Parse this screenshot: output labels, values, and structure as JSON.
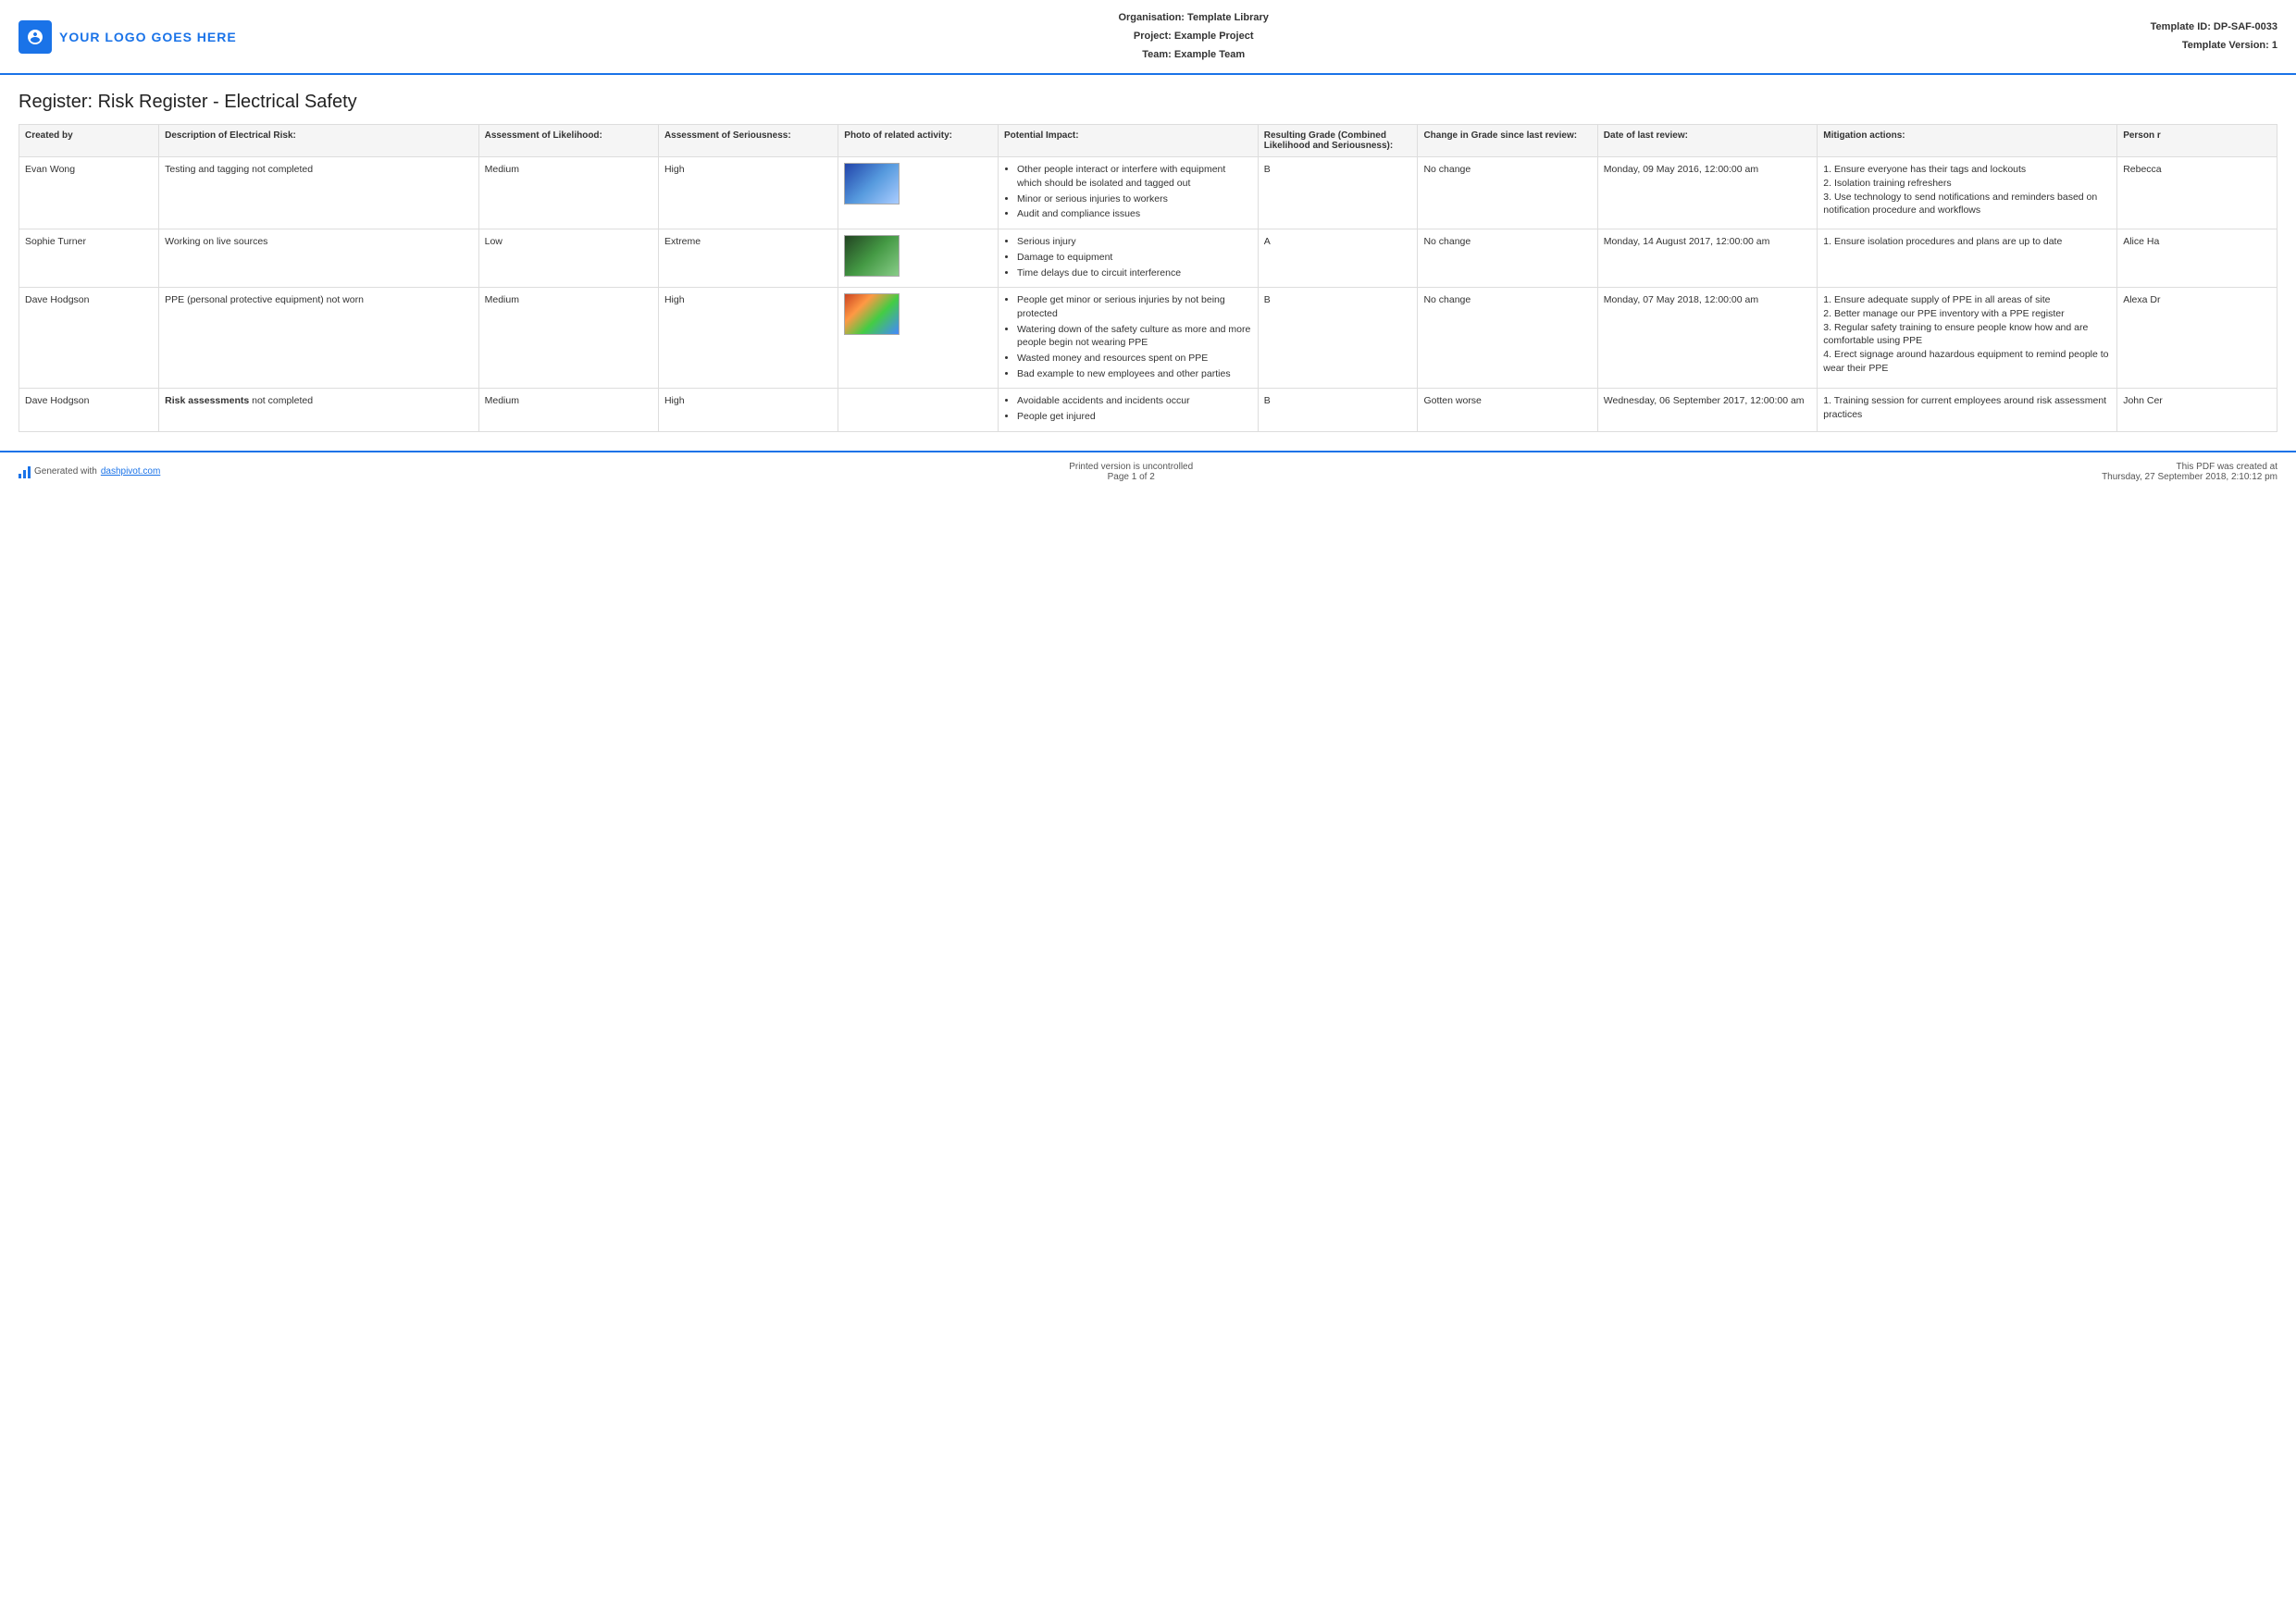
{
  "header": {
    "logo_text": "YOUR LOGO GOES HERE",
    "org_label": "Organisation:",
    "org_value": "Template Library",
    "project_label": "Project:",
    "project_value": "Example Project",
    "team_label": "Team:",
    "team_value": "Example Team",
    "template_id_label": "Template ID:",
    "template_id_value": "DP-SAF-0033",
    "template_version_label": "Template Version:",
    "template_version_value": "1"
  },
  "page_title": "Register: Risk Register - Electrical Safety",
  "table": {
    "columns": [
      "Created by",
      "Description of Electrical Risk:",
      "Assessment of Likelihood:",
      "Assessment of Seriousness:",
      "Photo of related activity:",
      "Potential Impact:",
      "Resulting Grade (Combined Likelihood and Seriousness):",
      "Change in Grade since last review:",
      "Date of last review:",
      "Mitigation actions:",
      "Person r"
    ],
    "rows": [
      {
        "created_by": "Evan Wong",
        "description": "Testing and tagging not completed",
        "likelihood": "Medium",
        "seriousness": "High",
        "has_photo": true,
        "photo_type": "blue",
        "impact": [
          "Other people interact or interfere with equipment which should be isolated and tagged out",
          "Minor or serious injuries to workers",
          "Audit and compliance issues"
        ],
        "grade": "B",
        "change": "No change",
        "date": "Monday, 09 May 2016, 12:00:00 am",
        "mitigation": "1. Ensure everyone has their tags and lockouts\n2. Isolation training refreshers\n3. Use technology to send notifications and reminders based on notification procedure and workflows",
        "person": "Rebecca"
      },
      {
        "created_by": "Sophie Turner",
        "description": "Working on live sources",
        "likelihood": "Low",
        "seriousness": "Extreme",
        "has_photo": true,
        "photo_type": "green",
        "impact": [
          "Serious injury",
          "Damage to equipment",
          "Time delays due to circuit interference"
        ],
        "grade": "A",
        "change": "No change",
        "date": "Monday, 14 August 2017, 12:00:00 am",
        "mitigation": "1. Ensure isolation procedures and plans are up to date",
        "person": "Alice Ha"
      },
      {
        "created_by": "Dave Hodgson",
        "description": "PPE (personal protective equipment) not worn",
        "likelihood": "Medium",
        "seriousness": "High",
        "has_photo": true,
        "photo_type": "multi",
        "impact": [
          "People get minor or serious injuries by not being protected",
          "Watering down of the safety culture as more and more people begin not wearing PPE",
          "Wasted money and resources spent on PPE",
          "Bad example to new employees and other parties"
        ],
        "grade": "B",
        "change": "No change",
        "date": "Monday, 07 May 2018, 12:00:00 am",
        "mitigation": "1. Ensure adequate supply of PPE in all areas of site\n2. Better manage our PPE inventory with a PPE register\n3. Regular safety training to ensure people know how and are comfortable using PPE\n4. Erect signage around hazardous equipment to remind people to wear their PPE",
        "person": "Alexa Dr"
      },
      {
        "created_by": "Dave Hodgson",
        "description_bold": "Risk assessments",
        "description_suffix": " not completed",
        "likelihood": "Medium",
        "seriousness": "High",
        "has_photo": false,
        "photo_type": null,
        "impact": [
          "Avoidable accidents and incidents occur",
          "People get injured"
        ],
        "grade": "B",
        "change": "Gotten worse",
        "date": "Wednesday, 06 September 2017, 12:00:00 am",
        "mitigation": "1. Training session for current employees around risk assessment practices",
        "person": "John Cer"
      }
    ]
  },
  "footer": {
    "generated_text": "Generated with ",
    "link_text": "dashpivot.com",
    "print_text": "Printed version is uncontrolled\nPage 1 of 2",
    "pdf_text": "This PDF was created at\nThursday, 27 September 2018, 2:10:12 pm"
  }
}
